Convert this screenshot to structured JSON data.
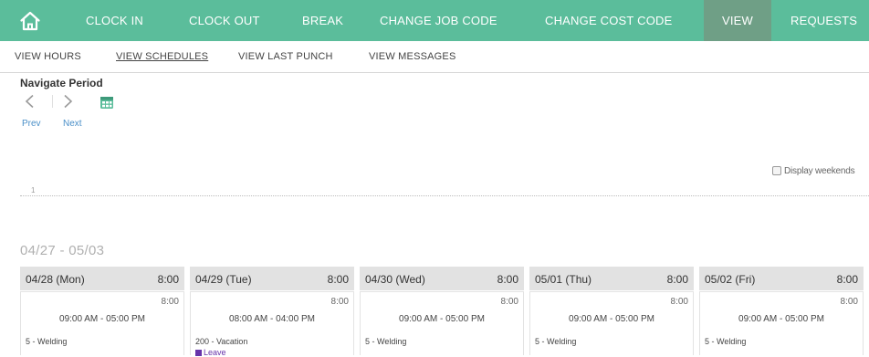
{
  "topnav": {
    "items": [
      {
        "label": "CLOCK IN"
      },
      {
        "label": "CLOCK OUT"
      },
      {
        "label": "BREAK"
      },
      {
        "label": "CHANGE JOB CODE"
      },
      {
        "label": "CHANGE COST CODE"
      },
      {
        "label": "VIEW"
      },
      {
        "label": "REQUESTS"
      }
    ],
    "active": "VIEW"
  },
  "subnav": {
    "items": [
      {
        "label": "VIEW HOURS"
      },
      {
        "label": "VIEW SCHEDULES"
      },
      {
        "label": "VIEW LAST PUNCH"
      },
      {
        "label": "VIEW MESSAGES"
      }
    ],
    "active": "VIEW SCHEDULES"
  },
  "navigate": {
    "title": "Navigate Period",
    "prev_label": "Prev",
    "next_label": "Next"
  },
  "display_weekends": {
    "label": "Display weekends",
    "checked": false
  },
  "week_index": "1",
  "period": {
    "title": "04/27 - 05/03"
  },
  "days": [
    {
      "date": "04/28 (Mon)",
      "total": "8:00",
      "shift_hours": "8:00",
      "time": "09:00 AM - 05:00 PM",
      "job": "5 - Welding"
    },
    {
      "date": "04/29 (Tue)",
      "total": "8:00",
      "shift_hours": "8:00",
      "time": "08:00 AM - 04:00 PM",
      "job": "200 - Vacation",
      "tag": "Leave"
    },
    {
      "date": "04/30 (Wed)",
      "total": "8:00",
      "shift_hours": "8:00",
      "time": "09:00 AM - 05:00 PM",
      "job": "5 - Welding"
    },
    {
      "date": "05/01 (Thu)",
      "total": "8:00",
      "shift_hours": "8:00",
      "time": "09:00 AM - 05:00 PM",
      "job": "5 - Welding"
    },
    {
      "date": "05/02 (Fri)",
      "total": "8:00",
      "shift_hours": "8:00",
      "time": "09:00 AM - 05:00 PM",
      "job": "5 - Welding"
    }
  ],
  "colors": {
    "nav_bg": "#5bbd9b",
    "nav_active_bg": "#6f9f86",
    "link": "#4a8fc8",
    "leave": "#6633aa",
    "day_header_bg": "#e2e2e2"
  },
  "icons": {
    "home": "home-icon",
    "prev": "chevron-left-icon",
    "next": "chevron-right-icon",
    "calendar": "calendar-icon",
    "leave": "leave-square-icon"
  }
}
